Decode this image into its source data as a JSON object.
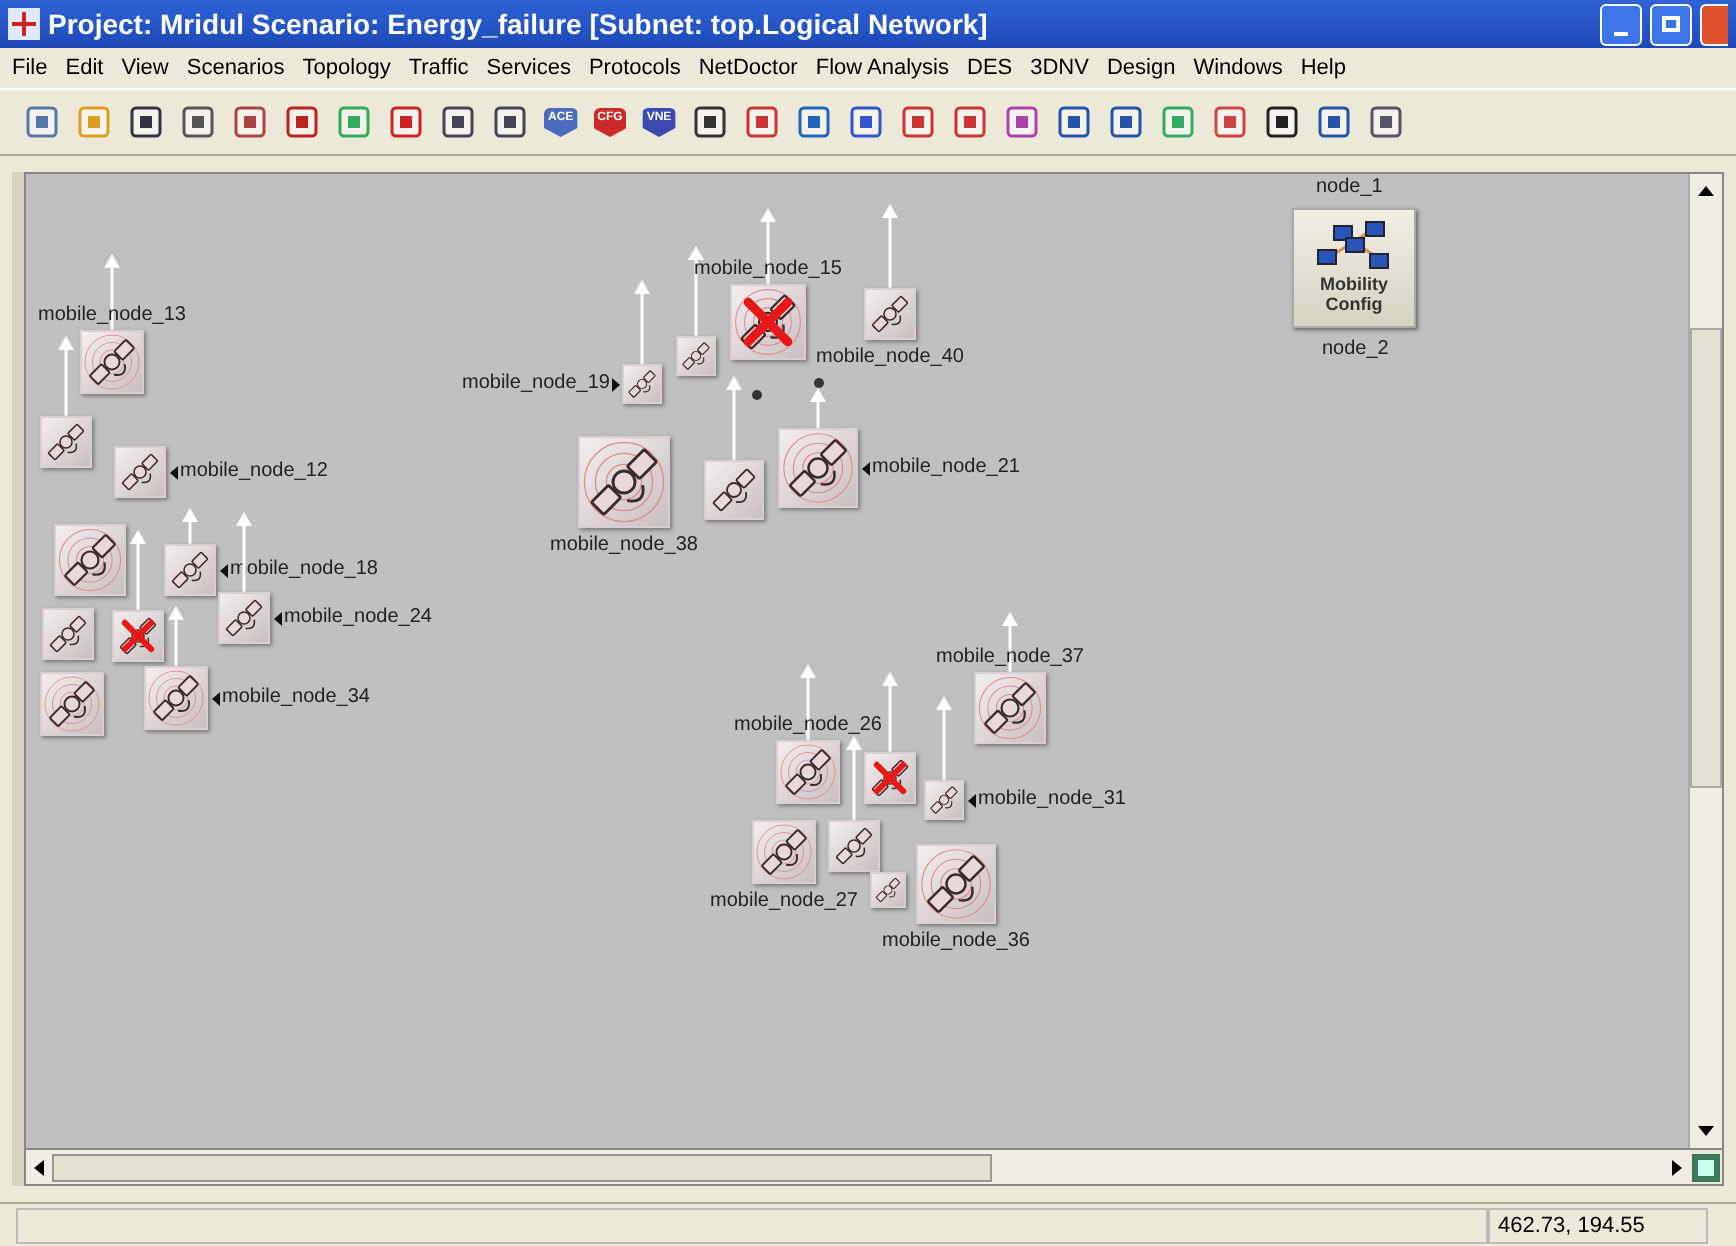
{
  "window": {
    "title": "Project: Mridul Scenario: Energy_failure  [Subnet: top.Logical Network]"
  },
  "menu": [
    "File",
    "Edit",
    "View",
    "Scenarios",
    "Topology",
    "Traffic",
    "Services",
    "Protocols",
    "NetDoctor",
    "Flow Analysis",
    "DES",
    "3DNV",
    "Design",
    "Windows",
    "Help"
  ],
  "toolbar_badges": [
    "ACE",
    "CFG",
    "VNE"
  ],
  "nodes": [
    {
      "label": "mobile_node_13",
      "failed": false
    },
    {
      "failed": false
    },
    {
      "label": "mobile_node_12",
      "failed": false
    },
    {
      "failed": false
    },
    {
      "label": "mobile_node_18",
      "failed": false
    },
    {
      "label": "mobile_node_24",
      "failed": false
    },
    {
      "failed": false
    },
    {
      "failed": true
    },
    {
      "failed": false
    },
    {
      "label": "mobile_node_34",
      "failed": false
    },
    {
      "label": "mobile_node_19",
      "failed": false
    },
    {
      "failed": false
    },
    {
      "label": "mobile_node_15",
      "failed": true
    },
    {
      "label": "mobile_node_40",
      "failed": false
    },
    {
      "label": "mobile_node_38",
      "failed": false
    },
    {
      "failed": false
    },
    {
      "label": "mobile_node_21",
      "failed": false
    },
    {
      "label": "mobile_node_37",
      "failed": false
    },
    {
      "label": "mobile_node_26",
      "failed": false
    },
    {
      "failed": true
    },
    {
      "label": "mobile_node_31",
      "failed": false
    },
    {
      "label": "mobile_node_27",
      "failed": false
    },
    {
      "failed": false
    },
    {
      "failed": false
    },
    {
      "label": "mobile_node_36",
      "failed": false
    }
  ],
  "config_node": {
    "title": "Mobility Config",
    "label_above": "node_1",
    "label_below": "node_2"
  },
  "status_bar": {
    "coordinates": "462.73, 194.55"
  }
}
